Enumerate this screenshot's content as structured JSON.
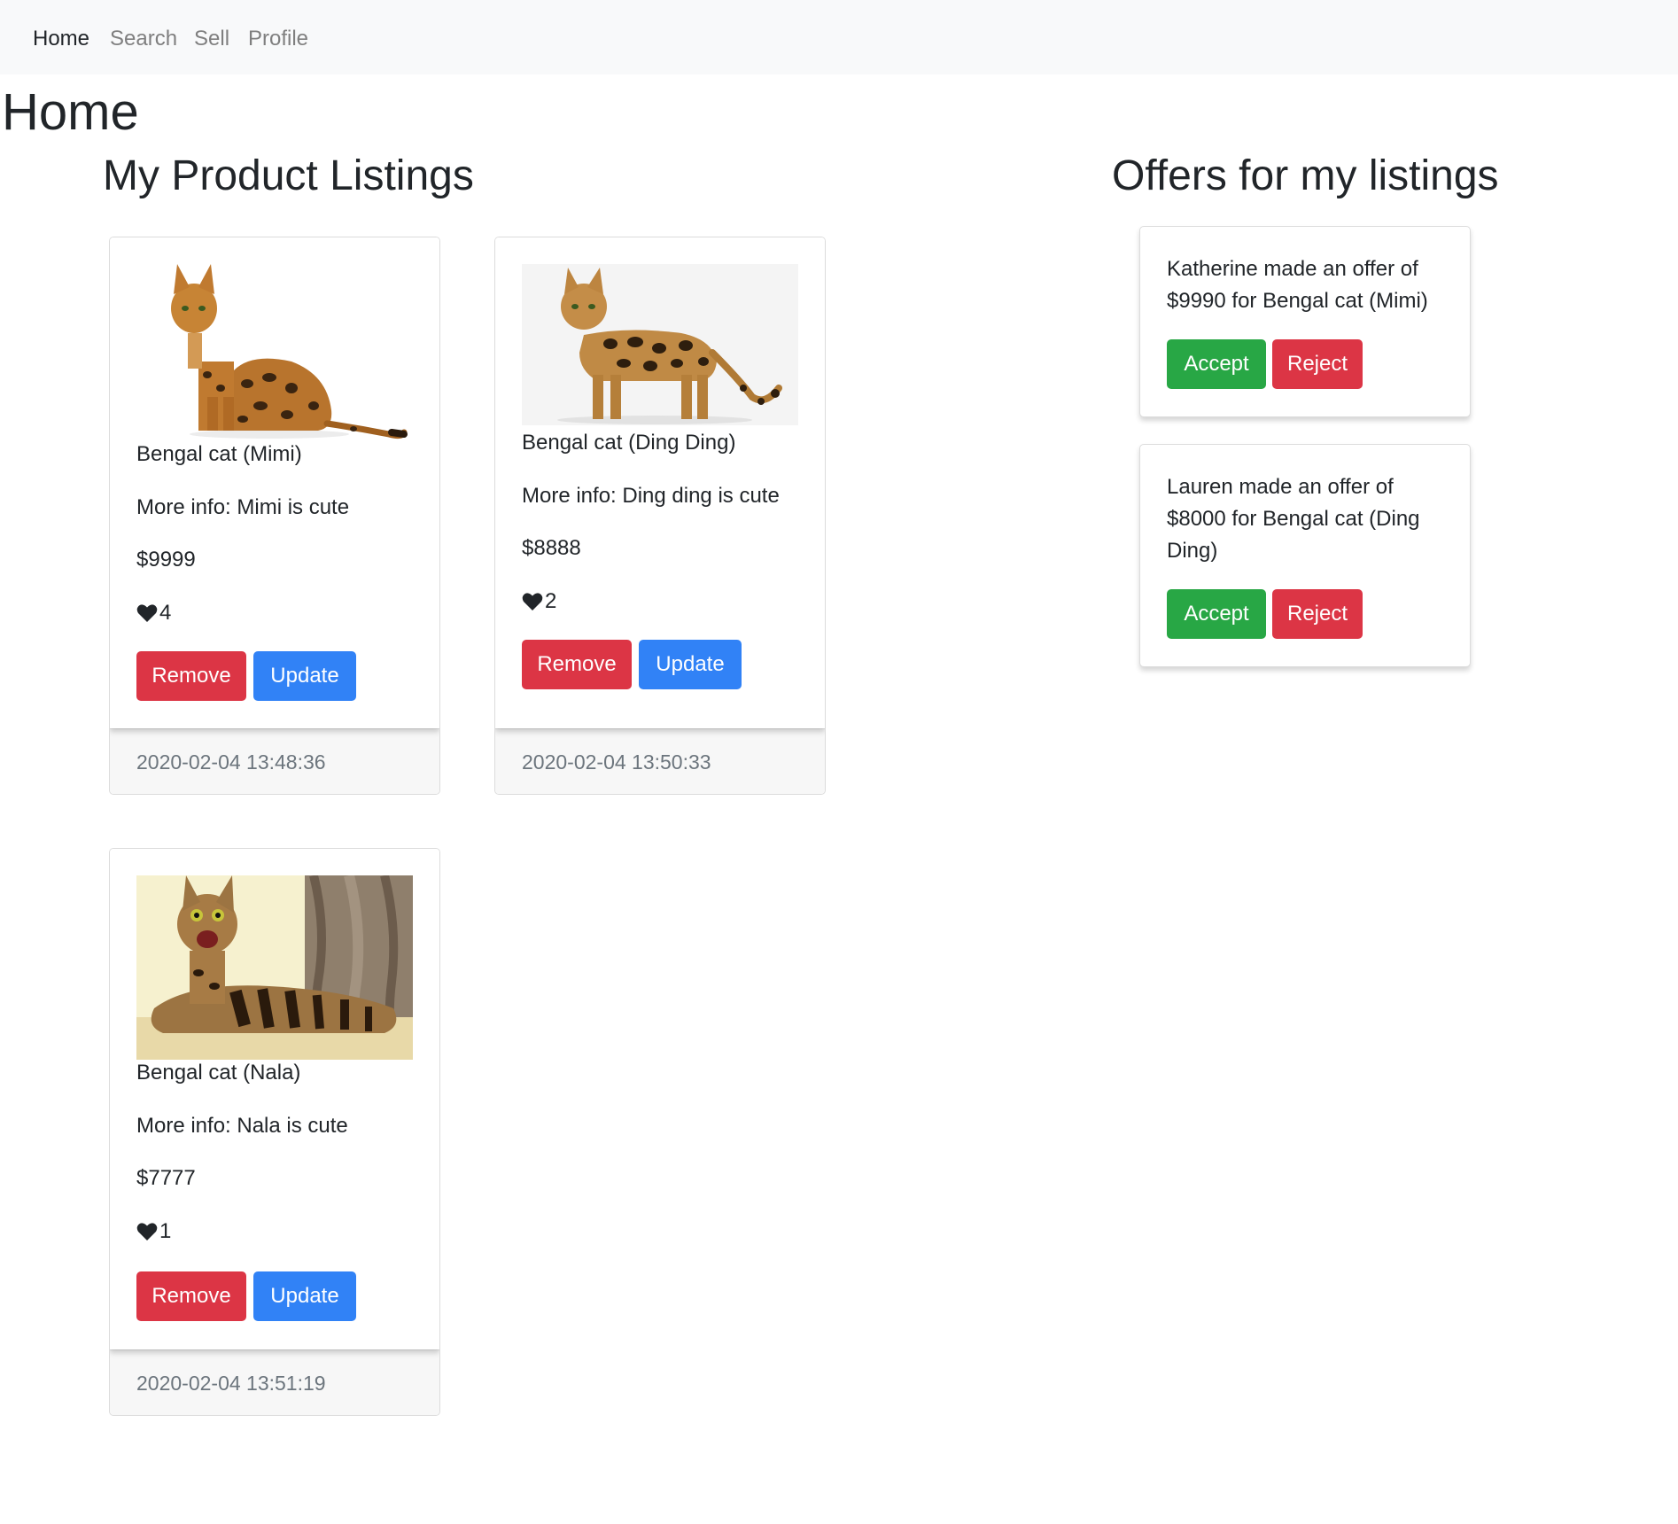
{
  "nav": {
    "items": [
      {
        "label": "Home",
        "active": true
      },
      {
        "label": "Search",
        "active": false
      },
      {
        "label": "Sell",
        "active": false
      },
      {
        "label": "Profile",
        "active": false
      }
    ]
  },
  "page": {
    "title": "Home"
  },
  "listings": {
    "heading": "My Product Listings",
    "items": [
      {
        "name": "Bengal cat (Mimi)",
        "info": "More info: Mimi is cute",
        "price": "$9999",
        "likes": "4",
        "remove_label": "Remove",
        "update_label": "Update",
        "timestamp": "2020-02-04 13:48:36"
      },
      {
        "name": "Bengal cat (Ding Ding)",
        "info": "More info: Ding ding is cute",
        "price": "$8888",
        "likes": "2",
        "remove_label": "Remove",
        "update_label": "Update",
        "timestamp": "2020-02-04 13:50:33"
      },
      {
        "name": "Bengal cat (Nala)",
        "info": "More info: Nala is cute",
        "price": "$7777",
        "likes": "1",
        "remove_label": "Remove",
        "update_label": "Update",
        "timestamp": "2020-02-04 13:51:19"
      }
    ]
  },
  "offers": {
    "heading": "Offers for my listings",
    "items": [
      {
        "text": "Katherine made an offer of $9990 for Bengal cat (Mimi)",
        "accept_label": "Accept",
        "reject_label": "Reject"
      },
      {
        "text": "Lauren made an offer of $8000 for Bengal cat (Ding Ding)",
        "accept_label": "Accept",
        "reject_label": "Reject"
      }
    ]
  },
  "icons": {
    "like": "heart-icon"
  },
  "colors": {
    "danger": "#dc3545",
    "primary": "#3182f6",
    "success": "#28a745",
    "navbar_bg": "#f8f9fa"
  }
}
